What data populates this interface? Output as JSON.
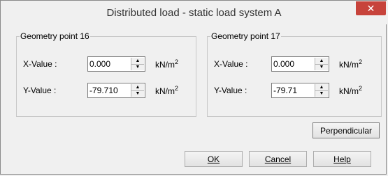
{
  "window": {
    "title": "Distributed load - static load system A",
    "close_glyph": "✕"
  },
  "groups": [
    {
      "title": "Geometry point 16",
      "x_label": "X-Value :",
      "x_value": "0.000",
      "x_unit": "kN/m",
      "x_unit_exp": "2",
      "y_label": "Y-Value :",
      "y_value": "-79.710",
      "y_unit": "kN/m",
      "y_unit_exp": "2"
    },
    {
      "title": "Geometry point 17",
      "x_label": "X-Value :",
      "x_value": "0.000",
      "x_unit": "kN/m",
      "x_unit_exp": "2",
      "y_label": "Y-Value :",
      "y_value": "-79.71",
      "y_unit": "kN/m",
      "y_unit_exp": "2"
    }
  ],
  "buttons": {
    "perpendicular": "Perpendicular",
    "ok": "OK",
    "cancel": "Cancel",
    "help": "Help"
  },
  "colors": {
    "close_button": "#c7433b",
    "dialog_bg": "#f0f0f0"
  }
}
